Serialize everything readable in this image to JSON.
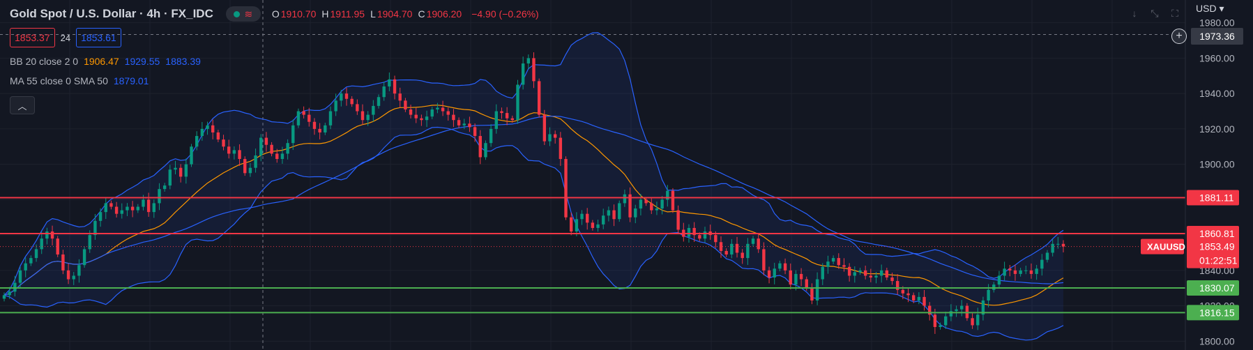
{
  "header": {
    "title": "Gold Spot / U.S. Dollar · 4h · FX_IDC",
    "ohlc": [
      {
        "k": "O",
        "v": "1910.70"
      },
      {
        "k": "H",
        "v": "1911.95"
      },
      {
        "k": "L",
        "v": "1904.70"
      },
      {
        "k": "C",
        "v": "1906.20"
      }
    ],
    "change": "−4.90 (−0.26%)"
  },
  "trade": {
    "sell": "1853.37",
    "spread": "24",
    "buy": "1853.61"
  },
  "indicators": {
    "bb": {
      "label": "BB 20 close 2 0",
      "basis": "1906.47",
      "upper": "1929.55",
      "lower": "1883.39"
    },
    "ma": {
      "label": "MA 55 close 0 SMA 50",
      "value": "1879.01"
    }
  },
  "currency": "USD",
  "hover_price": "1973.36",
  "colors": {
    "up": "#089981",
    "down": "#f23645",
    "bb": "#2962ff",
    "ma": "#ff9800",
    "red_level": "#f23645",
    "green_level": "#4caf50",
    "background": "#131722"
  },
  "icons": [
    "collapse-icon",
    "down-arrow-icon",
    "expand-icon",
    "fullscreen-icon",
    "plus-icon"
  ],
  "chart_data": {
    "type": "candlestick",
    "symbol": "XAUUSD",
    "current_price": "1853.49",
    "countdown": "01:22:51",
    "ylim": [
      1795,
      1985
    ],
    "y_ticks": [
      "1980.00",
      "1960.00",
      "1940.00",
      "1920.00",
      "1900.00",
      "1880.00",
      "1860.00",
      "1840.00",
      "1820.00",
      "1800.00"
    ],
    "levels": [
      {
        "label": "1881.11",
        "value": 1881.11,
        "type": "resistance"
      },
      {
        "label": "1860.81",
        "value": 1860.81,
        "type": "resistance"
      },
      {
        "label": "1830.07",
        "value": 1830.07,
        "type": "support"
      },
      {
        "label": "1816.15",
        "value": 1816.15,
        "type": "support"
      }
    ],
    "close": [
      1826,
      1828,
      1833,
      1840,
      1844,
      1847,
      1852,
      1858,
      1862,
      1858,
      1849,
      1840,
      1835,
      1837,
      1843,
      1852,
      1860,
      1868,
      1873,
      1878,
      1876,
      1872,
      1874,
      1876,
      1874,
      1876,
      1880,
      1873,
      1878,
      1886,
      1888,
      1897,
      1898,
      1893,
      1900,
      1910,
      1916,
      1920,
      1922,
      1918,
      1914,
      1910,
      1906,
      1908,
      1903,
      1895,
      1898,
      1905,
      1915,
      1911,
      1906,
      1903,
      1906,
      1912,
      1922,
      1930,
      1928,
      1924,
      1920,
      1918,
      1922,
      1930,
      1936,
      1940,
      1937,
      1934,
      1930,
      1925,
      1928,
      1933,
      1938,
      1944,
      1948,
      1940,
      1936,
      1931,
      1928,
      1926,
      1925,
      1927,
      1931,
      1932,
      1930,
      1928,
      1925,
      1922,
      1923,
      1921,
      1916,
      1904,
      1912,
      1920,
      1930,
      1929,
      1926,
      1925,
      1945,
      1957,
      1960,
      1947,
      1928,
      1913,
      1917,
      1915,
      1903,
      1870,
      1862,
      1869,
      1872,
      1867,
      1864,
      1866,
      1871,
      1874,
      1869,
      1878,
      1883,
      1870,
      1875,
      1880,
      1878,
      1874,
      1875,
      1880,
      1885,
      1874,
      1863,
      1859,
      1864,
      1860,
      1858,
      1862,
      1860,
      1856,
      1851,
      1849,
      1855,
      1850,
      1847,
      1855,
      1858,
      1852,
      1840,
      1836,
      1841,
      1844,
      1840,
      1832,
      1838,
      1835,
      1830,
      1823,
      1835,
      1842,
      1845,
      1847,
      1843,
      1842,
      1837,
      1839,
      1840,
      1837,
      1836,
      1837,
      1840,
      1836,
      1834,
      1829,
      1827,
      1826,
      1823,
      1825,
      1820,
      1815,
      1808,
      1809,
      1814,
      1817,
      1818,
      1820,
      1813,
      1809,
      1815,
      1823,
      1829,
      1832,
      1837,
      1841,
      1840,
      1838,
      1840,
      1840,
      1838,
      1841,
      1846,
      1850,
      1855,
      1855,
      1853.49
    ]
  }
}
